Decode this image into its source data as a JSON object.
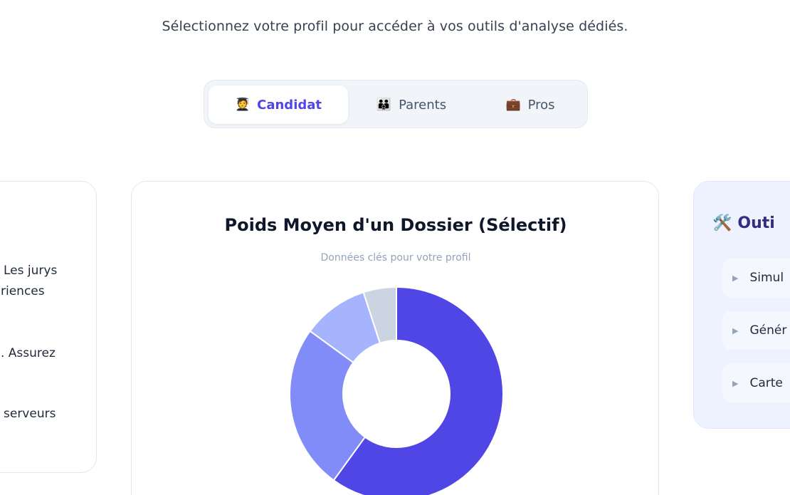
{
  "header": {
    "subtitle": "Sélectionnez votre profil pour accéder à vos outils d'analyse dédiés."
  },
  "tabs": [
    {
      "icon": "🧑‍🎓",
      "label": "Candidat",
      "active": true
    },
    {
      "icon": "👪",
      "label": "Parents",
      "active": false
    },
    {
      "icon": "💼",
      "label": "Pros",
      "active": false
    }
  ],
  "left_card": {
    "lines": [
      "Les jurys",
      "riences",
      ". Assurez",
      "serveurs"
    ]
  },
  "chart_card": {
    "title": "Poids Moyen d'un Dossier (Sélectif)",
    "subtitle": "Données clés pour votre profil"
  },
  "chart_data": {
    "type": "pie",
    "title": "Poids Moyen d'un Dossier (Sélectif)",
    "subtitle": "Données clés pour votre profil",
    "values": [
      60,
      25,
      10,
      5
    ],
    "colors": [
      "#4f46e5",
      "#818cf8",
      "#a5b4fc",
      "#cbd5e1"
    ],
    "donut": true
  },
  "tools_card": {
    "icon": "🛠️",
    "title": "Outi",
    "items": [
      "Simul",
      "Génér",
      "Carte"
    ]
  }
}
